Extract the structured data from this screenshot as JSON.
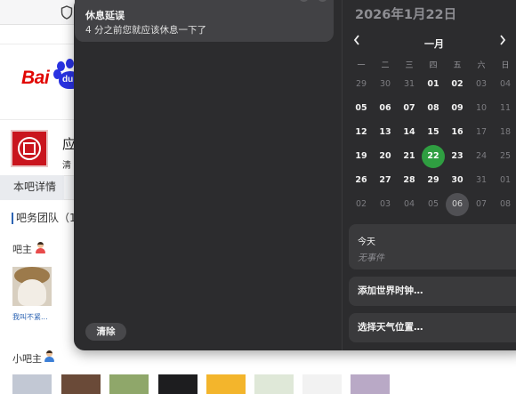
{
  "browser_page": {
    "logo_text": "Bai",
    "logo_paw_text": "du",
    "bar_title": "应",
    "bar_subtitle": "清",
    "tab_detail": "本吧详情",
    "team_heading": "吧务团队（1",
    "owner_label": "吧主",
    "owner_name": "我叫不紧...",
    "vice_owner_label": "小吧主"
  },
  "notification": {
    "title": "休息延误",
    "body": "4 分之前您就应该休息一下了",
    "clear_label": "清除"
  },
  "calendar": {
    "header_date": "2026年1月22日",
    "month_label": "一月",
    "prev_icon": "chevron-left",
    "next_icon": "chevron-right",
    "weekdays": [
      "一",
      "二",
      "三",
      "四",
      "五",
      "六",
      "日"
    ],
    "rows": [
      [
        "29",
        "30",
        "31",
        "01",
        "02",
        "03",
        "04"
      ],
      [
        "05",
        "06",
        "07",
        "08",
        "09",
        "10",
        "11"
      ],
      [
        "12",
        "13",
        "14",
        "15",
        "16",
        "17",
        "18"
      ],
      [
        "19",
        "20",
        "21",
        "22",
        "23",
        "24",
        "25"
      ],
      [
        "26",
        "27",
        "28",
        "29",
        "30",
        "31",
        "01"
      ],
      [
        "02",
        "03",
        "04",
        "05",
        "06",
        "07",
        "08"
      ]
    ],
    "today": "22",
    "today_card_title": "今天",
    "no_events": "无事件",
    "add_world_clock": "添加世界时钟…",
    "choose_weather": "选择天气位置…"
  },
  "colors": {
    "panel_bg": "#2c2c2e",
    "card_bg": "#424245",
    "today_highlight": "#2f9e41",
    "baidu_red": "#e10602",
    "baidu_blue": "#2932e1"
  }
}
